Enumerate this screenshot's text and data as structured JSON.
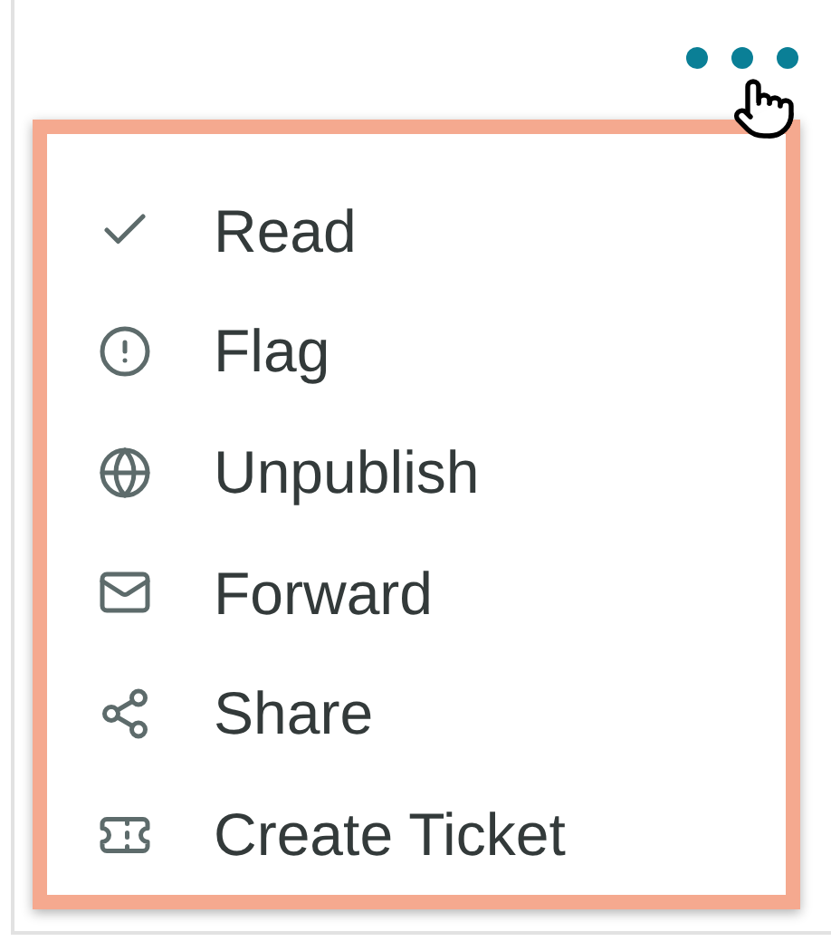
{
  "menu": {
    "items": [
      {
        "label": "Read"
      },
      {
        "label": "Flag"
      },
      {
        "label": "Unpublish"
      },
      {
        "label": "Forward"
      },
      {
        "label": "Share"
      },
      {
        "label": "Create Ticket"
      }
    ]
  }
}
